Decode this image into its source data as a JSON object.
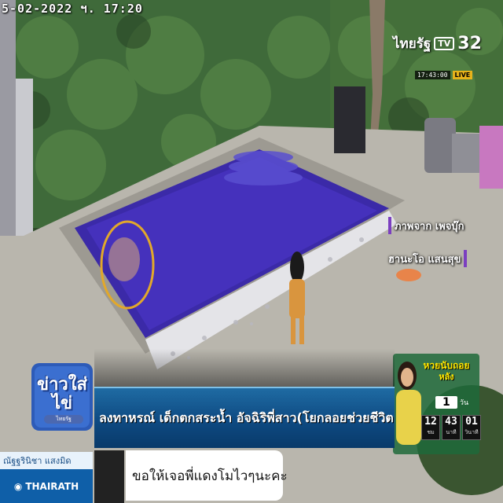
{
  "cctv": {
    "date": "5-02-2022",
    "weekday_mark": "ฯ.",
    "time": "17:20"
  },
  "channel": {
    "name": "ไทยรัฐ",
    "tv_label": "TV",
    "number": "32",
    "clock": "17:43:00",
    "live_label": "LIVE"
  },
  "credits": [
    {
      "text": "ภาพจาก เพจบุ๊ก"
    },
    {
      "text": "ฮานะโอ แสนสุข"
    }
  ],
  "show": {
    "title_line1": "ข่าวใส่",
    "title_line2": "ไข่",
    "subtitle": "ไทยรัฐ"
  },
  "headline": {
    "text": "ลงทาหรณ์ เด็กตกสระน้ำ อัจฉิริพี่สาว(โยกลอยช่วยชีวิต"
  },
  "lottery": {
    "title": "หวยนับถอย",
    "title2": "หลัง",
    "number": "1",
    "unit": "วัน",
    "countdown": [
      {
        "value": "12",
        "unit": "ชม"
      },
      {
        "value": "43",
        "unit": "นาที"
      },
      {
        "value": "01",
        "unit": "วินาที"
      }
    ]
  },
  "reporter": {
    "name": "ณัฐฐรินิชา แสงมิด"
  },
  "brand": {
    "name": "THAIRATH"
  },
  "comment": {
    "text": "ขอให้เจอพี่แดงโมไวๆนะคะ"
  },
  "colors": {
    "pool_water": "#3b2aa8",
    "headline_bg": "#0e4a82",
    "accent_purple": "#7b3fc0",
    "live": "#e7b21a"
  }
}
